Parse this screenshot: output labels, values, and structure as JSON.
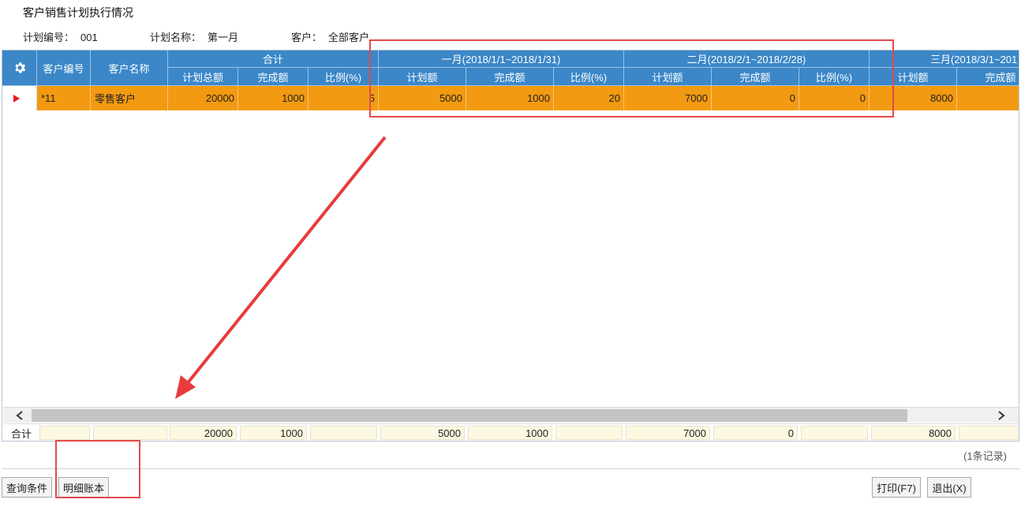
{
  "window": {
    "title": "客户销售计划执行情况"
  },
  "info": {
    "plan_no_label": "计划编号：",
    "plan_no": "001",
    "plan_name_label": "计划名称：",
    "plan_name": "第一月",
    "customer_label": "客户：",
    "customer": "全部客户"
  },
  "grid": {
    "col_customer_no": "客户编号",
    "col_customer_name": "客户名称",
    "groups": [
      {
        "label": "合计",
        "sub": [
          "计划总额",
          "完成额",
          "比例(%)"
        ]
      },
      {
        "label": "一月(2018/1/1~2018/1/31)",
        "sub": [
          "计划额",
          "完成额",
          "比例(%)"
        ]
      },
      {
        "label": "二月(2018/2/1~2018/2/28)",
        "sub": [
          "计划额",
          "完成额",
          "比例(%)"
        ]
      },
      {
        "label": "三月(2018/3/1~201",
        "sub": [
          "计划额",
          "完成额"
        ]
      }
    ],
    "rows": [
      {
        "customer_no": "*11",
        "customer_name": "零售客户",
        "values": [
          "20000",
          "1000",
          "5",
          "5000",
          "1000",
          "20",
          "7000",
          "0",
          "0",
          "8000",
          ""
        ]
      }
    ],
    "totals_label": "合计",
    "totals": [
      "",
      "",
      "20000",
      "1000",
      "",
      "5000",
      "1000",
      "",
      "7000",
      "0",
      "",
      "8000",
      ""
    ]
  },
  "status": {
    "records": "(1条记录)"
  },
  "buttons": {
    "query": "查询条件",
    "detail": "明细账本",
    "print": "打印(F7)",
    "exit": "退出(X)"
  },
  "colors": {
    "header_blue": "#3b87c8",
    "row_orange": "#f29a11",
    "annotation_red": "#e24a4a"
  },
  "icons": {
    "settings": "gear-icon",
    "row_pointer": "triangle-right-icon",
    "scroll_left": "chevron-left-icon",
    "scroll_right": "chevron-right-icon"
  }
}
